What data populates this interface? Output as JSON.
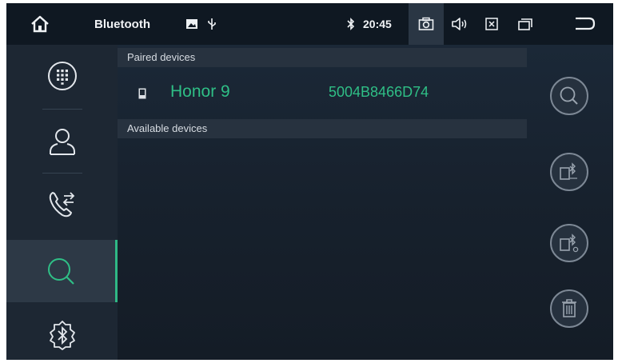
{
  "status_bar": {
    "title": "Bluetooth",
    "time": "20:45",
    "icons": [
      "home-icon",
      "image-icon",
      "usb-icon",
      "bluetooth-icon",
      "screenshot-icon",
      "volume-icon",
      "close-app-icon",
      "multi-window-icon",
      "back-icon"
    ]
  },
  "sidebar": {
    "items": [
      {
        "name": "dialpad",
        "icon": "dialpad-icon"
      },
      {
        "name": "contacts",
        "icon": "contact-icon"
      },
      {
        "name": "call-log",
        "icon": "call-transfer-icon"
      },
      {
        "name": "search",
        "icon": "search-icon",
        "active": true
      },
      {
        "name": "bluetooth-settings",
        "icon": "bluetooth-settings-icon"
      }
    ]
  },
  "main": {
    "paired_header": "Paired devices",
    "available_header": "Available devices",
    "paired_devices": [
      {
        "name": "Honor 9",
        "address": "5004B8466D74"
      }
    ]
  },
  "actions": {
    "buttons": [
      "search-icon",
      "connect-device-icon",
      "disconnect-device-icon",
      "delete-icon"
    ]
  },
  "colors": {
    "accent": "#2fbf86",
    "background": "#17212d",
    "status_bar": "#0f1822"
  }
}
